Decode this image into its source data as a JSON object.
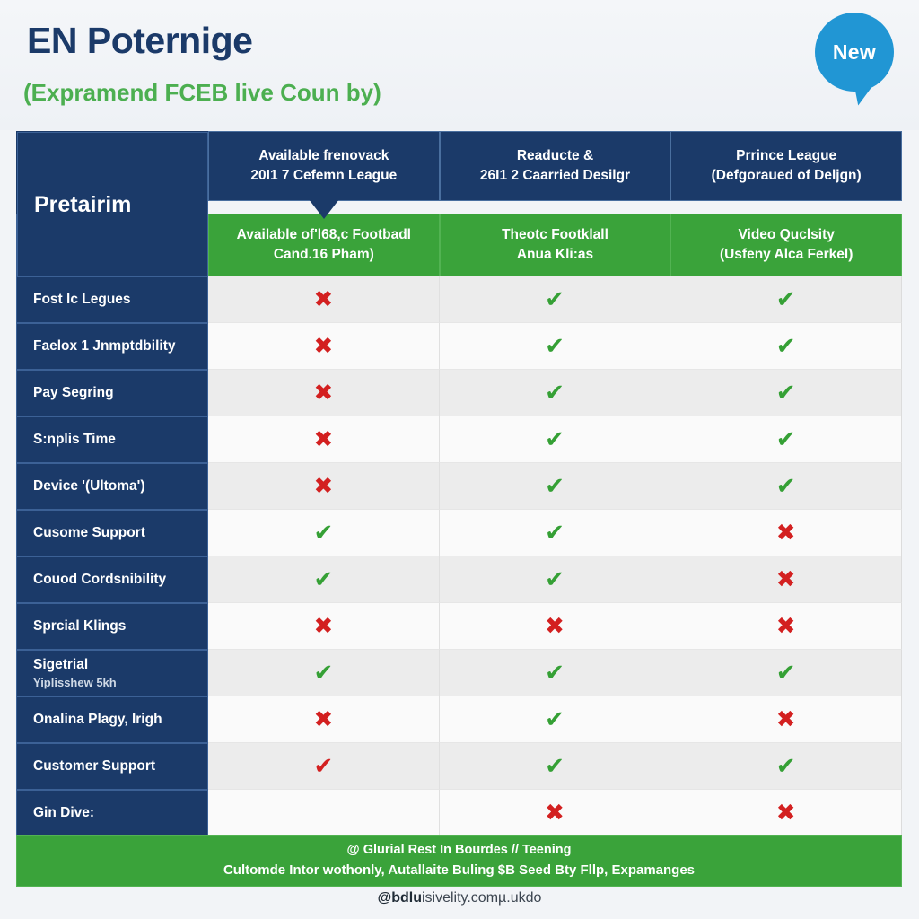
{
  "header": {
    "title": "EN Poternige",
    "subtitle": "(Expramend FCEB live Coun by)",
    "badge_label": "New",
    "badge_color": "#2196d4"
  },
  "colors": {
    "navy": "#1b3a69",
    "green": "#3aa33a",
    "red": "#d32020",
    "check_green": "#35a035",
    "page_bg": "#f2f4f7",
    "row_even": "#ececec",
    "row_odd": "#fafafa"
  },
  "table": {
    "corner_label": "Pretairim",
    "columns": [
      {
        "top_line1": "Available frenovack",
        "top_line2": "20I1 7 Cefemn League",
        "sub_line1": "Available of'l68,c Footbadl",
        "sub_line2": "Cand.16 Pham)"
      },
      {
        "top_line1": "Readucte &",
        "top_line2": "26I1 2 Caarried Desilgr",
        "sub_line1": "Theotc Footklall",
        "sub_line2": "Anua Kli:as"
      },
      {
        "top_line1": "Prrince League",
        "top_line2": "(Defgoraued of Deljgn)",
        "sub_line1": "Video Quclsity",
        "sub_line2": "(Usfeny Alca Ferkel)"
      }
    ],
    "rows": [
      {
        "label": "Fost lc Legues",
        "sublabel": "",
        "marks": [
          "no",
          "yes",
          "yes"
        ]
      },
      {
        "label": "Faelox 1 Jnmptdbility",
        "sublabel": "",
        "marks": [
          "no",
          "yes",
          "yes"
        ]
      },
      {
        "label": "Pay Segring",
        "sublabel": "",
        "marks": [
          "no",
          "yes",
          "yes"
        ]
      },
      {
        "label": "S:nplis Time",
        "sublabel": "",
        "marks": [
          "no",
          "yes",
          "yes"
        ]
      },
      {
        "label": "Device '(Ultoma')",
        "sublabel": "",
        "marks": [
          "no",
          "yes",
          "yes"
        ]
      },
      {
        "label": "Cusome Support",
        "sublabel": "",
        "marks": [
          "yes",
          "yes",
          "no"
        ]
      },
      {
        "label": "Couod Cordsnibility",
        "sublabel": "",
        "marks": [
          "yes",
          "yes",
          "no"
        ]
      },
      {
        "label": "Sprcial Klings",
        "sublabel": "",
        "marks": [
          "no",
          "no",
          "no"
        ]
      },
      {
        "label": "Sigetrial",
        "sublabel": "Yiplisshew 5kh",
        "marks": [
          "yes",
          "yes",
          "yes"
        ]
      },
      {
        "label": "Onalina Plagy, Irigh",
        "sublabel": "",
        "marks": [
          "no",
          "yes",
          "no"
        ]
      },
      {
        "label": "Customer Support",
        "sublabel": "",
        "marks": [
          "yes-red",
          "yes",
          "yes"
        ]
      },
      {
        "label": "Gin Dive:",
        "sublabel": "",
        "marks": [
          "blank",
          "no",
          "no"
        ]
      }
    ]
  },
  "footer": {
    "line1": "@ Glurial Rest In Bourdes // Teening",
    "line2": "Cultomde Intor wothonly, Autallaite Buling $B Seed Bty Fllp, Expamanges",
    "url_bold": "@bdlu",
    "url_rest": "isivelity.comµ.ukdo"
  },
  "marks": {
    "yes_glyph": "✔",
    "no_glyph": "✖",
    "blank_glyph": ""
  }
}
